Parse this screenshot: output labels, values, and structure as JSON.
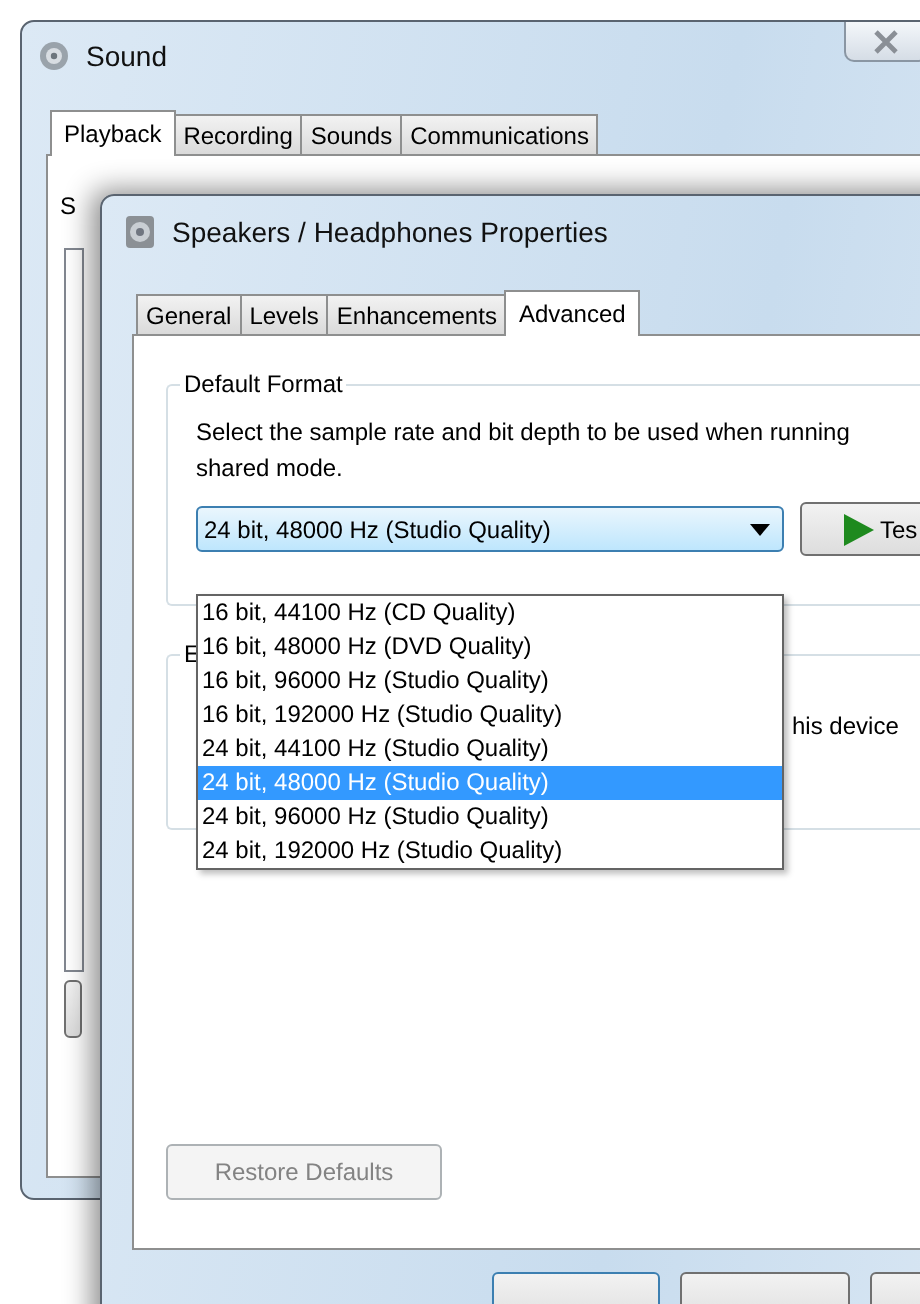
{
  "sound_window": {
    "title": "Sound",
    "tabs": [
      {
        "label": "Playback",
        "selected": true
      },
      {
        "label": "Recording",
        "selected": false
      },
      {
        "label": "Sounds",
        "selected": false
      },
      {
        "label": "Communications",
        "selected": false
      }
    ],
    "instruction": "S"
  },
  "properties_window": {
    "title": "Speakers / Headphones Properties",
    "tabs": [
      {
        "label": "General",
        "selected": false
      },
      {
        "label": "Levels",
        "selected": false
      },
      {
        "label": "Enhancements",
        "selected": false
      },
      {
        "label": "Advanced",
        "selected": true
      }
    ],
    "default_format": {
      "label": "Default Format",
      "description": [
        "Select the sample rate and bit depth to be used when running",
        "shared mode."
      ],
      "format_dropdown": {
        "value": "24 bit, 48000 Hz (Studio Quality)",
        "expanded": true,
        "options": [
          {
            "label": "16 bit, 44100 Hz (CD Quality)",
            "selected": false
          },
          {
            "label": "16 bit, 48000 Hz (DVD Quality)",
            "selected": false
          },
          {
            "label": "16 bit, 96000 Hz (Studio Quality)",
            "selected": false
          },
          {
            "label": "16 bit, 192000 Hz (Studio Quality)",
            "selected": false
          },
          {
            "label": "24 bit, 44100 Hz (Studio Quality)",
            "selected": false
          },
          {
            "label": "24 bit, 48000 Hz (Studio Quality)",
            "selected": true
          },
          {
            "label": "24 bit, 96000 Hz (Studio Quality)",
            "selected": false
          },
          {
            "label": "24 bit, 192000 Hz (Studio Quality)",
            "selected": false
          }
        ]
      },
      "test_button": "Tes"
    },
    "exclusive_mode": {
      "label": "E",
      "option_text": "his device"
    },
    "restore_defaults": {
      "label": "Restore Defaults",
      "disabled": true
    }
  }
}
